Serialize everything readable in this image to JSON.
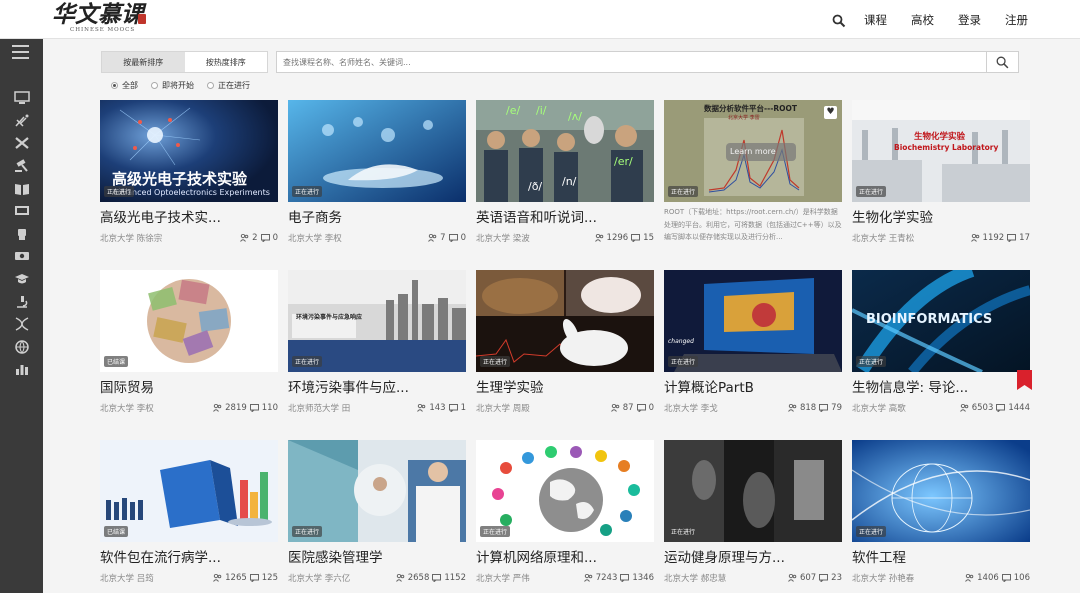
{
  "brand": {
    "logo_text": "华文慕课",
    "logo_sub": "CHINESE MOOCS"
  },
  "nav": {
    "courses": "课程",
    "schools": "高校",
    "login": "登录",
    "register": "注册"
  },
  "toolbar": {
    "sort_newest": "按最新排序",
    "sort_hot": "按热度排序",
    "search_placeholder": "查找课程名称、名师姓名、关键词..."
  },
  "filters": {
    "all": "全部",
    "upcoming": "即将开始",
    "ongoing": "正在进行",
    "selected": "all"
  },
  "courses": [
    {
      "title": "高级光电子技术实...",
      "school": "北京大学 陈徐宗",
      "students": "2",
      "comments": "0",
      "status": "正在进行",
      "thumb_cn": "高级光电子技术实验",
      "thumb_en": "Advanced Optoelectronics Experiments"
    },
    {
      "title": "电子商务",
      "school": "北京大学 李权",
      "students": "7",
      "comments": "0",
      "status": "正在进行"
    },
    {
      "title": "英语语音和听说词...",
      "school": "北京大学 梁波",
      "students": "1296",
      "comments": "15",
      "status": "",
      "thumb_symbols": [
        "/e/",
        "/i/",
        "/ʌ/",
        "/ð/",
        "/n/",
        "/er/"
      ]
    },
    {
      "title": "",
      "school": "",
      "students": "",
      "comments": "",
      "status": "正在进行",
      "thumb_title": "数据分析软件平台---ROOT",
      "thumb_sub": "北京大学 李雷",
      "hover": "Learn more",
      "description": "ROOT（下载地址：https://root.cern.ch/）是科学数据处理的平台。利用它，可将数据（包括通过C++等）以及编写脚本以便存储实现以及进行分析..."
    },
    {
      "title": "生物化学实验",
      "school": "北京大学 王青松",
      "students": "1192",
      "comments": "17",
      "status": "正在进行",
      "thumb_cn": "生物化学实验",
      "thumb_en": "Biochemistry Laboratory"
    },
    {
      "title": "国际贸易",
      "school": "北京大学 李权",
      "students": "2819",
      "comments": "110",
      "status": "已结课"
    },
    {
      "title": "环境污染事件与应...",
      "school": "北京师范大学 田",
      "students": "143",
      "comments": "1",
      "status": "正在进行",
      "thumb_title": "环境污染事件与应急响应"
    },
    {
      "title": "生理学实验",
      "school": "北京大学 周殿",
      "students": "87",
      "comments": "0",
      "status": "正在进行"
    },
    {
      "title": "计算概论PartB",
      "school": "北京大学 李戈",
      "students": "818",
      "comments": "79",
      "status": "正在进行",
      "thumb_text": "changed"
    },
    {
      "title": "生物信息学: 导论...",
      "school": "北京大学 高歌",
      "students": "6503",
      "comments": "1444",
      "status": "正在进行",
      "thumb_text": "BIOINFORMATICS"
    },
    {
      "title": "软件包在流行病学...",
      "school": "北京大学 吕筠",
      "students": "1265",
      "comments": "125",
      "status": "已结课"
    },
    {
      "title": "医院感染管理学",
      "school": "北京大学 李六亿",
      "students": "2658",
      "comments": "1152",
      "status": "正在进行"
    },
    {
      "title": "计算机网络原理和...",
      "school": "北京大学 严伟",
      "students": "7243",
      "comments": "1346",
      "status": "正在进行"
    },
    {
      "title": "运动健身原理与方...",
      "school": "北京大学 郝忠慧",
      "students": "607",
      "comments": "23",
      "status": "正在进行"
    },
    {
      "title": "软件工程",
      "school": "北京大学 孙艳春",
      "students": "1406",
      "comments": "106",
      "status": "正在进行"
    }
  ],
  "colors": {
    "sidebar": "#3a3a3a",
    "bookmark": "#d9212c"
  }
}
